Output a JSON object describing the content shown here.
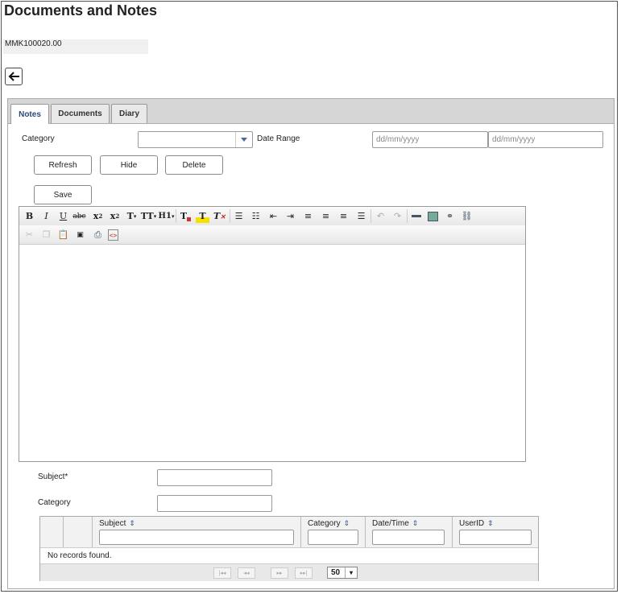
{
  "page": {
    "title": "Documents and Notes",
    "record_id": "MMK100020.00"
  },
  "tabs": [
    {
      "label": "Notes",
      "active": true
    },
    {
      "label": "Documents",
      "active": false
    },
    {
      "label": "Diary",
      "active": false
    }
  ],
  "filters": {
    "category_label": "Category",
    "category_value": "",
    "date_range_label": "Date Range",
    "date_from_placeholder": "dd/mm/yyyy",
    "date_to_placeholder": "dd/mm/yyyy"
  },
  "buttons": {
    "refresh": "Refresh",
    "hide": "Hide",
    "delete": "Delete",
    "save": "Save"
  },
  "editor": {
    "toolbar_row1": [
      "bold-icon",
      "italic-icon",
      "underline-icon",
      "strikethrough-icon",
      "subscript-icon",
      "superscript-icon",
      "font-icon",
      "font-size-icon",
      "heading-icon",
      "text-color-icon",
      "highlight-icon",
      "clear-format-icon",
      "bullet-list-icon",
      "numbered-list-icon",
      "outdent-icon",
      "indent-icon",
      "align-left-icon",
      "align-center-icon",
      "align-right-icon",
      "justify-icon",
      "undo-icon",
      "redo-icon",
      "horizontal-rule-icon",
      "image-icon",
      "link-icon",
      "unlink-icon"
    ],
    "toolbar_row2": [
      "cut-icon",
      "copy-icon",
      "paste-icon",
      "paste-text-icon",
      "print-icon",
      "source-icon"
    ],
    "content": ""
  },
  "form": {
    "subject_label": "Subject*",
    "category_label": "Category",
    "subject_value": "",
    "category_value": ""
  },
  "grid": {
    "columns": [
      {
        "label": "Subject"
      },
      {
        "label": "Category"
      },
      {
        "label": "Date/Time"
      },
      {
        "label": "UserID"
      }
    ],
    "empty_message": "No records found.",
    "page_size": "50"
  }
}
